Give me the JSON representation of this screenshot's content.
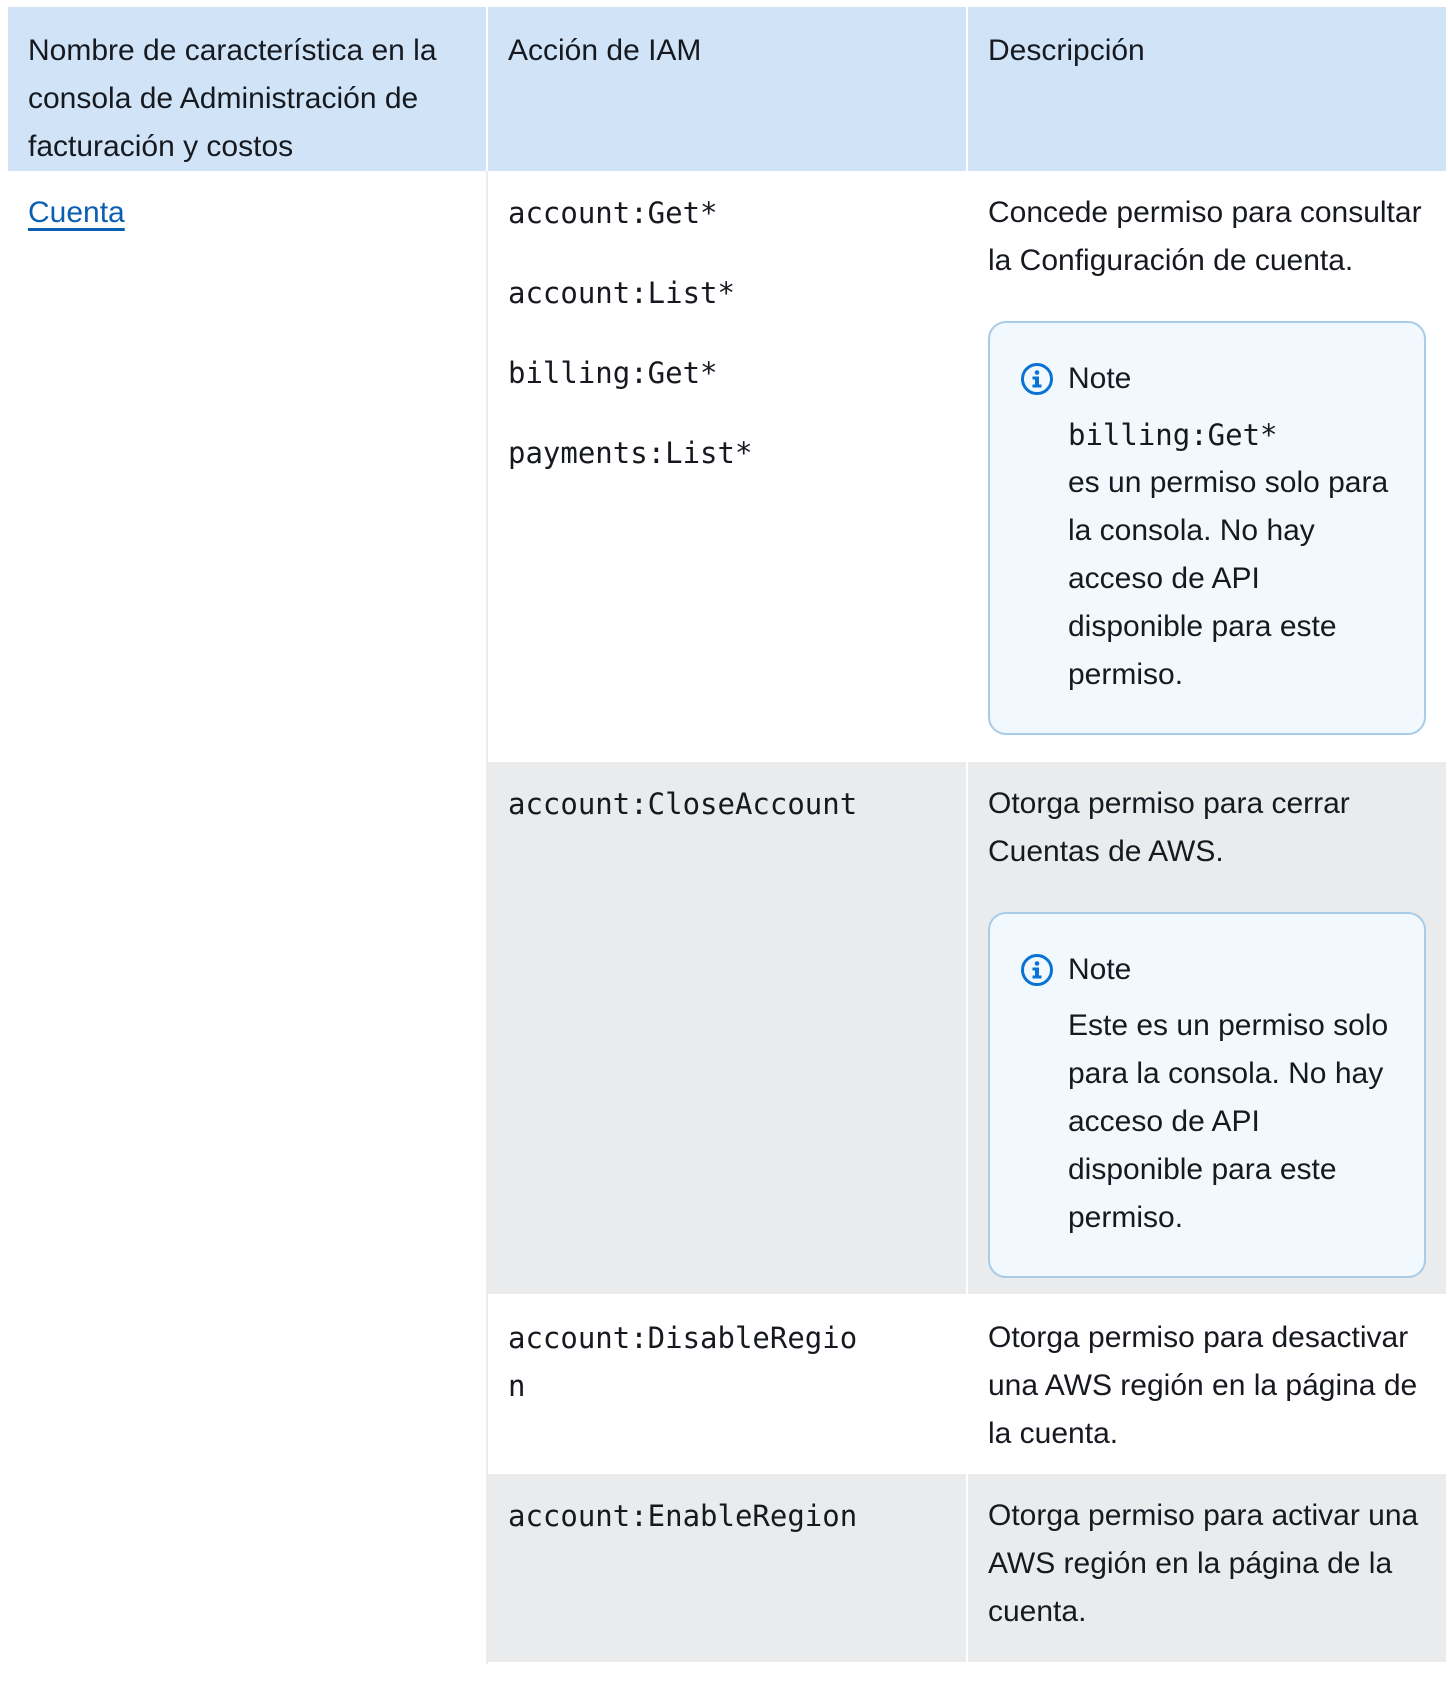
{
  "headers": {
    "feature": "Nombre de característica en la consola de Administración de facturación y costos",
    "action": "Acción de IAM",
    "description": "Descripción"
  },
  "feature_link": "Cuenta",
  "rows": [
    {
      "actions": [
        "account:Get*",
        "account:List*",
        "billing:Get*",
        "payments:List*"
      ],
      "description": "Concede permiso para consultar la Configuración de cuenta.",
      "note": {
        "title": "Note",
        "code": "billing:Get*",
        "text": "es un permiso solo para la consola. No hay acceso de API disponible para este permiso."
      }
    },
    {
      "actions": [
        "account:CloseAccount"
      ],
      "description": "Otorga permiso para cerrar Cuentas de AWS.",
      "note": {
        "title": "Note",
        "text": "Este es un permiso solo para la consola. No hay acceso de API disponible para este permiso."
      }
    },
    {
      "actions": [
        "account:DisableRegion"
      ],
      "description": "Otorga permiso para desactivar una AWS región en la página de la cuenta."
    },
    {
      "actions": [
        "account:EnableRegion"
      ],
      "description": "Otorga permiso para activar una AWS región en la página de la cuenta."
    }
  ],
  "colors": {
    "header_bg": "#d1e4f7",
    "row_alt_bg": "#e9ebed",
    "note_bg": "#f1f8fe",
    "note_border": "#a8cbe8",
    "link": "#0b5fb3",
    "icon": "#0972d3"
  }
}
